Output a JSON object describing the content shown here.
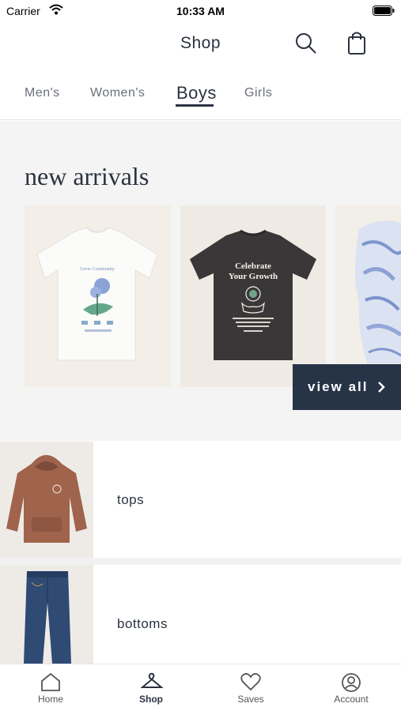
{
  "status_bar": {
    "carrier": "Carrier",
    "time": "10:33 AM"
  },
  "header": {
    "title": "Shop",
    "search_icon": "search-icon",
    "bag_icon": "shopping-bag-icon"
  },
  "tabs": [
    {
      "label": "Men's",
      "active": false
    },
    {
      "label": "Women's",
      "active": false
    },
    {
      "label": "Boys",
      "active": true
    },
    {
      "label": "Girls",
      "active": false
    }
  ],
  "new_arrivals": {
    "title": "new arrivals",
    "products": [
      {
        "image": "white-graphic-tshirt"
      },
      {
        "image": "black-celebrate-your-growth-tshirt",
        "print_text": "Celebrate Your Growth"
      },
      {
        "image": "blue-marble-hoodie"
      }
    ],
    "view_all_label": "view all"
  },
  "categories": [
    {
      "label": "tops",
      "image": "brown-hoodie"
    },
    {
      "label": "bottoms",
      "image": "blue-jeans"
    }
  ],
  "bottom_nav": [
    {
      "label": "Home",
      "icon": "home-icon",
      "active": false
    },
    {
      "label": "Shop",
      "icon": "hanger-icon",
      "active": true
    },
    {
      "label": "Saves",
      "icon": "heart-icon",
      "active": false
    },
    {
      "label": "Account",
      "icon": "account-icon",
      "active": false
    }
  ],
  "colors": {
    "accent": "#273447",
    "text": "#2b3340",
    "section_bg": "#f4f4f4"
  }
}
